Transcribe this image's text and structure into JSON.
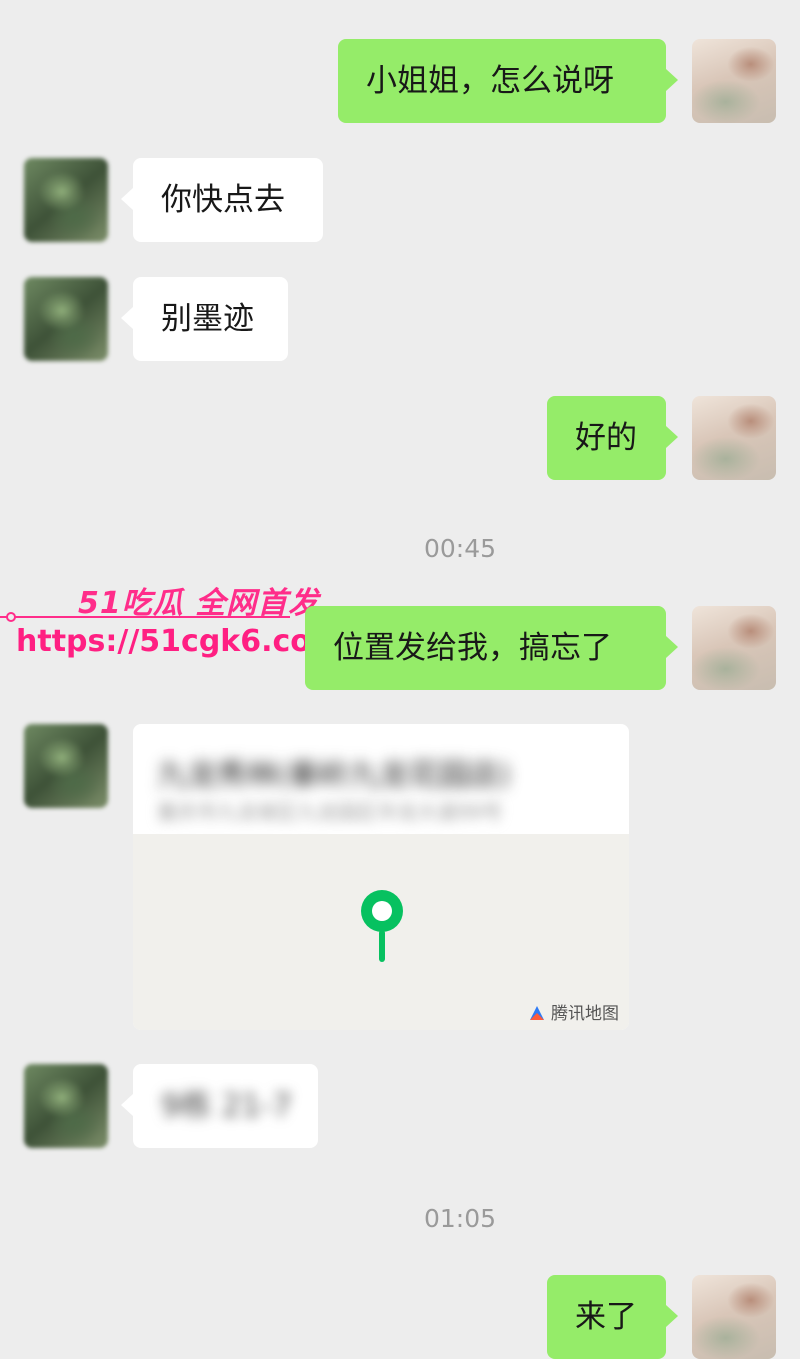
{
  "messages": [
    {
      "text": "小姐姐，怎么说呀"
    },
    {
      "text": "你快点去"
    },
    {
      "text": "别墨迹"
    },
    {
      "text": "好的"
    },
    {
      "text": "位置发给我，搞忘了"
    },
    {
      "text": "9栋 21-7"
    },
    {
      "text": "来了"
    }
  ],
  "timestamps": [
    "00:45",
    "01:05"
  ],
  "location": {
    "name": "九龙秀林(秦岭九龙花园店)",
    "address": "重庆市九龙坡区九龙园区华龙大道99号",
    "provider": "腾讯地图",
    "pin_icon": "map-pin-icon",
    "pin_color": "#07c160"
  },
  "watermark": {
    "title": "51吃瓜 全网首发",
    "url": "https://51cgk6.com",
    "color": "#ff2d8a"
  },
  "colors": {
    "background": "#ededed",
    "outgoing_bubble": "#95ec69",
    "incoming_bubble": "#ffffff"
  }
}
